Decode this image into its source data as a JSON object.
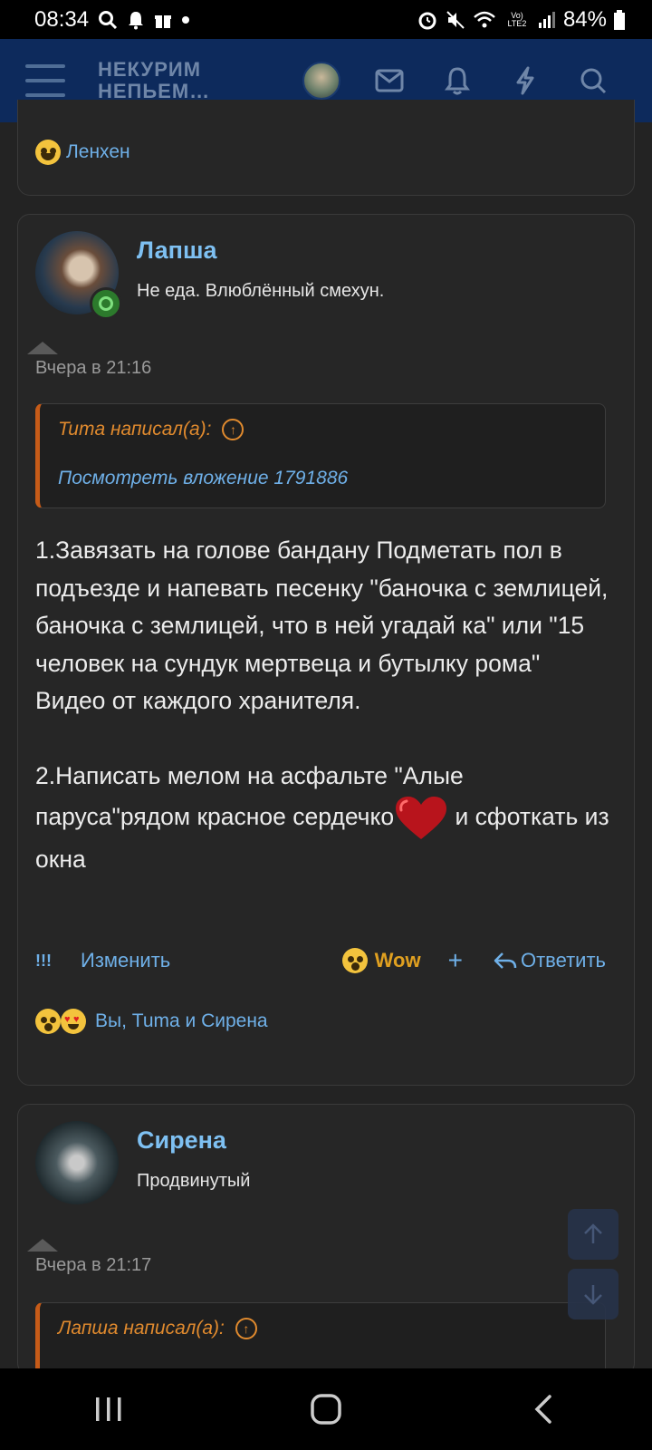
{
  "status_bar": {
    "time": "08:34",
    "battery": "84%",
    "network": "Vo) LTE2"
  },
  "header": {
    "logo_line1": "НЕКУРИМ",
    "logo_line2": "НЕПЬЕМ…"
  },
  "prev_post": {
    "reactions_text": "Ленхен"
  },
  "post": {
    "username": "Лапша",
    "user_title": "Не еда. Влюблённый смехун.",
    "timestamp": "Вчера в 21:16",
    "quote_author": "Tuma написал(а):",
    "quote_link": "Посмотреть вложение 1791886",
    "body_part1": "1.Завязать на голове бандану Подметать пол в подъезде и напевать песенку \"баночка с землицей, баночка с землицей, что в ней угадай ка\" или \"15 человек на сундук мертвеца и бутылку рома\"\nВидео от каждого хранителя.\n\n2.Написать мелом на асфальте \"Алые паруса\"рядом красное сердечко",
    "body_part2": " и сфоткать из окна",
    "actions": {
      "report": "!!!",
      "edit": "Изменить",
      "wow": "Wow",
      "plus": "+",
      "reply": "Ответить"
    },
    "reactions_text": "Вы, Tuma и Сирена"
  },
  "next_post": {
    "username": "Сирена",
    "user_title": "Продвинутый",
    "timestamp": "Вчера в 21:17",
    "quote_author": "Лапша написал(а):"
  },
  "colors": {
    "header_bg": "#0d2a5c",
    "link": "#6fb0e8",
    "quote_accent": "#c65b18"
  }
}
